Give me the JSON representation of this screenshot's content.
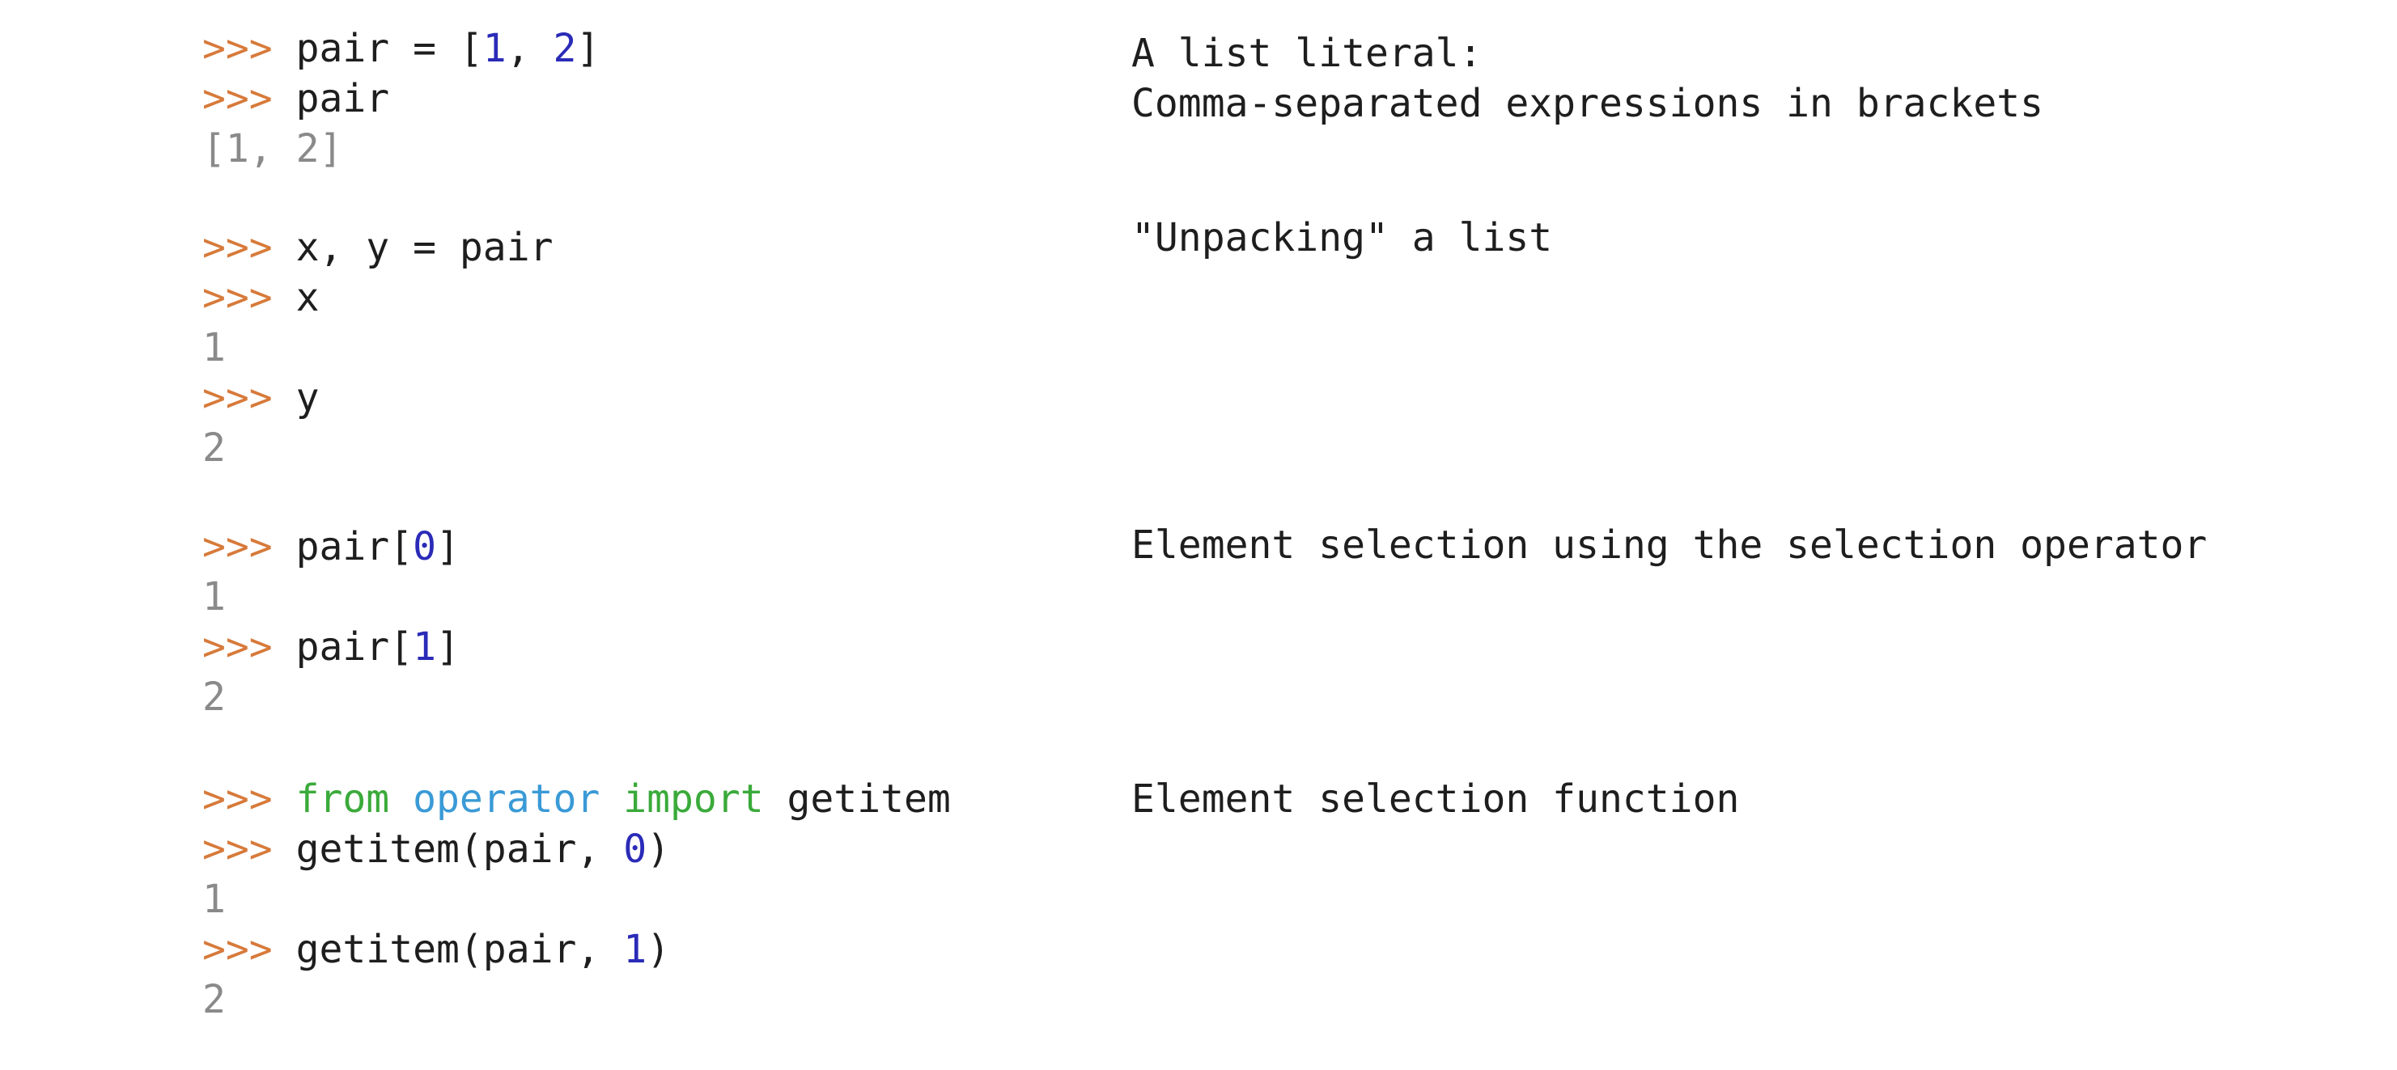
{
  "prompt": ">>>",
  "colors": {
    "prompt": "#d77a3a",
    "output": "#8a8a8a",
    "number": "#2b2bb8",
    "keyword": "#3aaa3a",
    "module": "#3a9ad6",
    "text": "#1e1e1e"
  },
  "sections": {
    "list_literal": {
      "line1": {
        "pre": "pair = [",
        "n1": "1",
        "mid": ", ",
        "n2": "2",
        "post": "]"
      },
      "line2": "pair",
      "output": "[1, 2]",
      "note1": "A list literal:",
      "note2": "Comma-separated expressions in brackets"
    },
    "unpacking": {
      "line1": "x, y = pair",
      "line2": "x",
      "output1": "1",
      "line3": "y",
      "output2": "2",
      "note": "\"Unpacking\" a list"
    },
    "selection_operator": {
      "line1": {
        "pre": "pair[",
        "n": "0",
        "post": "]"
      },
      "output1": "1",
      "line2": {
        "pre": "pair[",
        "n": "1",
        "post": "]"
      },
      "output2": "2",
      "note": "Element selection using the selection operator"
    },
    "selection_function": {
      "import": {
        "kw_from": "from",
        "module": "operator",
        "kw_import": "import",
        "name": "getitem"
      },
      "line2": {
        "pre": "getitem(pair, ",
        "n": "0",
        "post": ")"
      },
      "output1": "1",
      "line3": {
        "pre": "getitem(pair, ",
        "n": "1",
        "post": ")"
      },
      "output2": "2",
      "note": "Element selection function"
    }
  }
}
